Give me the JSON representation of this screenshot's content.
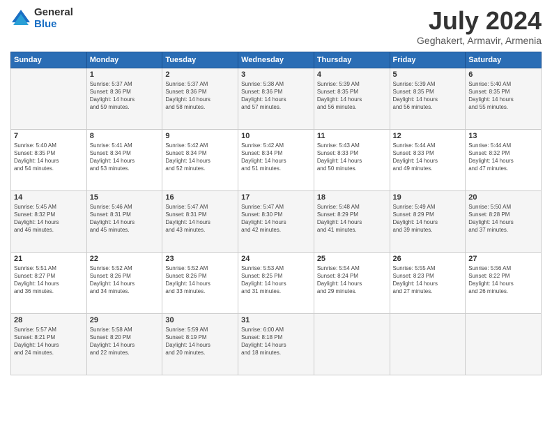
{
  "header": {
    "logo_general": "General",
    "logo_blue": "Blue",
    "month_title": "July 2024",
    "location": "Geghakert, Armavir, Armenia"
  },
  "weekdays": [
    "Sunday",
    "Monday",
    "Tuesday",
    "Wednesday",
    "Thursday",
    "Friday",
    "Saturday"
  ],
  "weeks": [
    [
      {
        "day": "",
        "info": ""
      },
      {
        "day": "1",
        "info": "Sunrise: 5:37 AM\nSunset: 8:36 PM\nDaylight: 14 hours\nand 59 minutes."
      },
      {
        "day": "2",
        "info": "Sunrise: 5:37 AM\nSunset: 8:36 PM\nDaylight: 14 hours\nand 58 minutes."
      },
      {
        "day": "3",
        "info": "Sunrise: 5:38 AM\nSunset: 8:36 PM\nDaylight: 14 hours\nand 57 minutes."
      },
      {
        "day": "4",
        "info": "Sunrise: 5:39 AM\nSunset: 8:35 PM\nDaylight: 14 hours\nand 56 minutes."
      },
      {
        "day": "5",
        "info": "Sunrise: 5:39 AM\nSunset: 8:35 PM\nDaylight: 14 hours\nand 56 minutes."
      },
      {
        "day": "6",
        "info": "Sunrise: 5:40 AM\nSunset: 8:35 PM\nDaylight: 14 hours\nand 55 minutes."
      }
    ],
    [
      {
        "day": "7",
        "info": "Sunrise: 5:40 AM\nSunset: 8:35 PM\nDaylight: 14 hours\nand 54 minutes."
      },
      {
        "day": "8",
        "info": "Sunrise: 5:41 AM\nSunset: 8:34 PM\nDaylight: 14 hours\nand 53 minutes."
      },
      {
        "day": "9",
        "info": "Sunrise: 5:42 AM\nSunset: 8:34 PM\nDaylight: 14 hours\nand 52 minutes."
      },
      {
        "day": "10",
        "info": "Sunrise: 5:42 AM\nSunset: 8:34 PM\nDaylight: 14 hours\nand 51 minutes."
      },
      {
        "day": "11",
        "info": "Sunrise: 5:43 AM\nSunset: 8:33 PM\nDaylight: 14 hours\nand 50 minutes."
      },
      {
        "day": "12",
        "info": "Sunrise: 5:44 AM\nSunset: 8:33 PM\nDaylight: 14 hours\nand 49 minutes."
      },
      {
        "day": "13",
        "info": "Sunrise: 5:44 AM\nSunset: 8:32 PM\nDaylight: 14 hours\nand 47 minutes."
      }
    ],
    [
      {
        "day": "14",
        "info": "Sunrise: 5:45 AM\nSunset: 8:32 PM\nDaylight: 14 hours\nand 46 minutes."
      },
      {
        "day": "15",
        "info": "Sunrise: 5:46 AM\nSunset: 8:31 PM\nDaylight: 14 hours\nand 45 minutes."
      },
      {
        "day": "16",
        "info": "Sunrise: 5:47 AM\nSunset: 8:31 PM\nDaylight: 14 hours\nand 43 minutes."
      },
      {
        "day": "17",
        "info": "Sunrise: 5:47 AM\nSunset: 8:30 PM\nDaylight: 14 hours\nand 42 minutes."
      },
      {
        "day": "18",
        "info": "Sunrise: 5:48 AM\nSunset: 8:29 PM\nDaylight: 14 hours\nand 41 minutes."
      },
      {
        "day": "19",
        "info": "Sunrise: 5:49 AM\nSunset: 8:29 PM\nDaylight: 14 hours\nand 39 minutes."
      },
      {
        "day": "20",
        "info": "Sunrise: 5:50 AM\nSunset: 8:28 PM\nDaylight: 14 hours\nand 37 minutes."
      }
    ],
    [
      {
        "day": "21",
        "info": "Sunrise: 5:51 AM\nSunset: 8:27 PM\nDaylight: 14 hours\nand 36 minutes."
      },
      {
        "day": "22",
        "info": "Sunrise: 5:52 AM\nSunset: 8:26 PM\nDaylight: 14 hours\nand 34 minutes."
      },
      {
        "day": "23",
        "info": "Sunrise: 5:52 AM\nSunset: 8:26 PM\nDaylight: 14 hours\nand 33 minutes."
      },
      {
        "day": "24",
        "info": "Sunrise: 5:53 AM\nSunset: 8:25 PM\nDaylight: 14 hours\nand 31 minutes."
      },
      {
        "day": "25",
        "info": "Sunrise: 5:54 AM\nSunset: 8:24 PM\nDaylight: 14 hours\nand 29 minutes."
      },
      {
        "day": "26",
        "info": "Sunrise: 5:55 AM\nSunset: 8:23 PM\nDaylight: 14 hours\nand 27 minutes."
      },
      {
        "day": "27",
        "info": "Sunrise: 5:56 AM\nSunset: 8:22 PM\nDaylight: 14 hours\nand 26 minutes."
      }
    ],
    [
      {
        "day": "28",
        "info": "Sunrise: 5:57 AM\nSunset: 8:21 PM\nDaylight: 14 hours\nand 24 minutes."
      },
      {
        "day": "29",
        "info": "Sunrise: 5:58 AM\nSunset: 8:20 PM\nDaylight: 14 hours\nand 22 minutes."
      },
      {
        "day": "30",
        "info": "Sunrise: 5:59 AM\nSunset: 8:19 PM\nDaylight: 14 hours\nand 20 minutes."
      },
      {
        "day": "31",
        "info": "Sunrise: 6:00 AM\nSunset: 8:18 PM\nDaylight: 14 hours\nand 18 minutes."
      },
      {
        "day": "",
        "info": ""
      },
      {
        "day": "",
        "info": ""
      },
      {
        "day": "",
        "info": ""
      }
    ]
  ]
}
